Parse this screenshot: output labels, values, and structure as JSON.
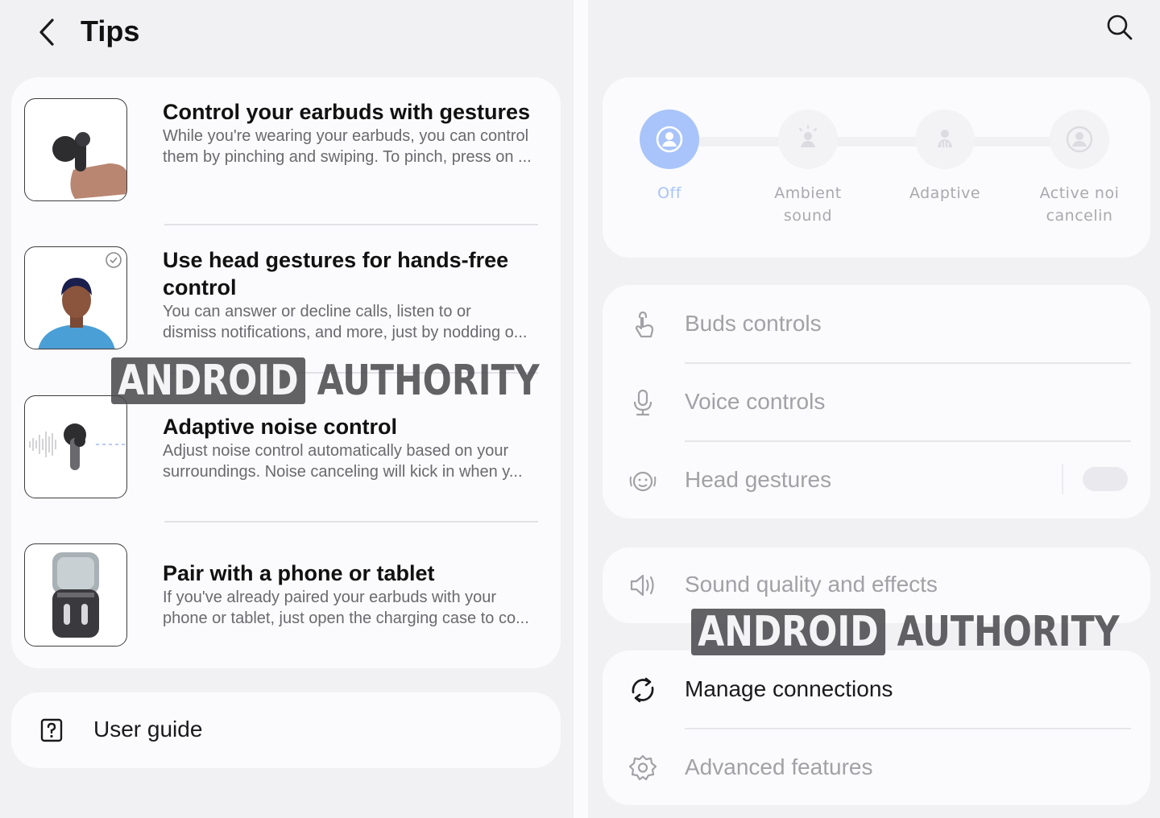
{
  "left": {
    "header": {
      "title": "Tips"
    },
    "tips": [
      {
        "title": "Control your earbuds with gestures",
        "desc1": "While you're wearing your earbuds, you can control",
        "desc2": "them by pinching and swiping. To pinch, press on ..."
      },
      {
        "title": "Use head gestures for hands-free",
        "title2": "control",
        "desc1": "You can answer or decline calls, listen to or",
        "desc2": "dismiss notifications, and more, just by nodding o..."
      },
      {
        "title": "Adaptive noise control",
        "desc1": "Adjust noise control automatically based on your",
        "desc2": "surroundings. Noise canceling will kick in when y..."
      },
      {
        "title": "Pair with a phone or tablet",
        "desc1": "If you've already paired your earbuds with your",
        "desc2": "phone or tablet, just open the charging case to co..."
      }
    ],
    "user_guide": {
      "label": "User guide"
    }
  },
  "right": {
    "noise_control": {
      "options": [
        {
          "line1": "Off",
          "line2": ""
        },
        {
          "line1": "Ambient",
          "line2": "sound"
        },
        {
          "line1": "Adaptive",
          "line2": ""
        },
        {
          "line1": "Active noi",
          "line2": "cancelin"
        }
      ],
      "selected": "Off"
    },
    "controls": {
      "buds": "Buds controls",
      "voice": "Voice controls",
      "head": "Head gestures",
      "head_toggle_on": false
    },
    "sound": {
      "label": "Sound quality and effects"
    },
    "connections": {
      "manage": "Manage connections",
      "advanced": "Advanced features"
    }
  },
  "watermark": {
    "box": "ANDROID",
    "text": "AUTHORITY"
  },
  "colors": {
    "accent": "#a8c4fa",
    "muted_text": "#a2a2a6",
    "card_bg": "#fbfbfd",
    "page_bg": "#f1f1f4"
  }
}
